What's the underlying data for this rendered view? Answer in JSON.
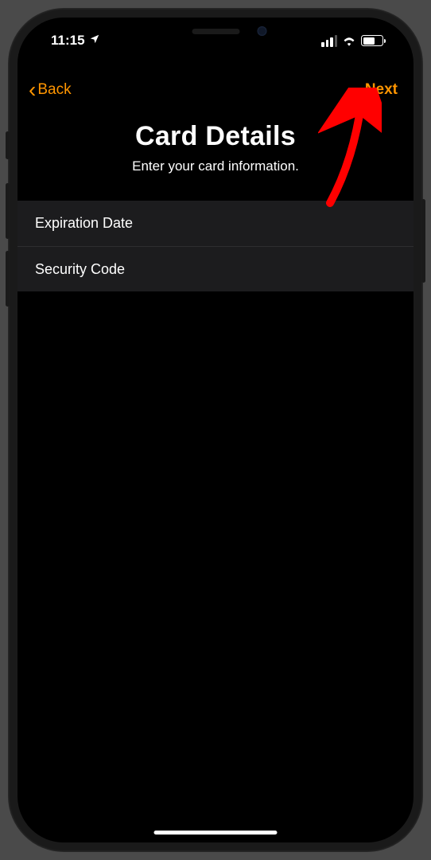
{
  "status_bar": {
    "time": "11:15",
    "location_enabled": true,
    "cellular_bars": 3,
    "wifi": true,
    "battery_percent": 55
  },
  "nav": {
    "back_label": "Back",
    "next_label": "Next"
  },
  "header": {
    "title": "Card Details",
    "subtitle": "Enter your card information."
  },
  "form": {
    "rows": [
      {
        "label": "Expiration Date"
      },
      {
        "label": "Security Code"
      }
    ]
  },
  "accent_color": "#ff9500",
  "annotation": {
    "type": "arrow",
    "points_to": "nav-next-button",
    "color": "#ff0000"
  }
}
